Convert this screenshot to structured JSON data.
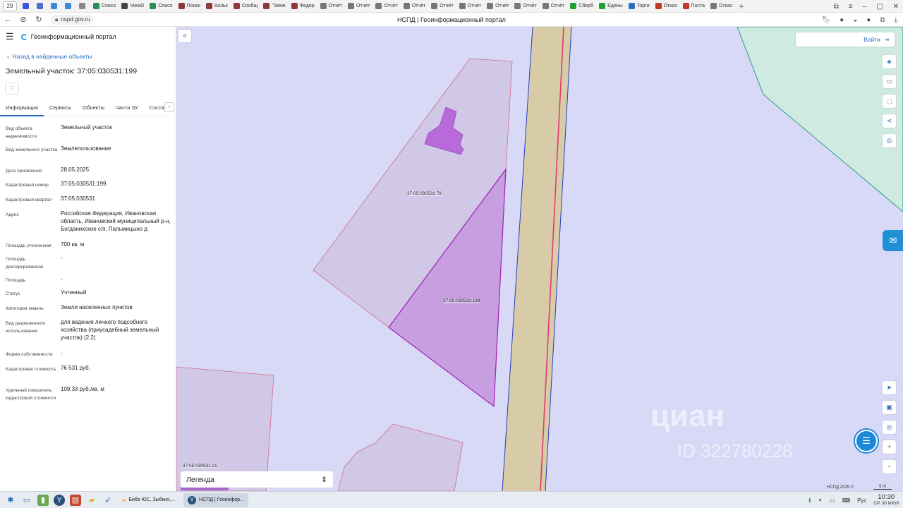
{
  "browser": {
    "tab_count": "29",
    "tabs": [
      {
        "label": "",
        "color": "#3a57d9"
      },
      {
        "label": "",
        "color": "#4a6fd0"
      },
      {
        "label": "",
        "color": "#3f8ad6"
      },
      {
        "label": "",
        "color": "#3f8ad6"
      },
      {
        "label": "",
        "color": "#888888"
      },
      {
        "label": "Списо",
        "color": "#2e8b57"
      },
      {
        "label": "ViewD",
        "color": "#444444"
      },
      {
        "label": "Списо",
        "color": "#2e8b57"
      },
      {
        "label": "Поиск",
        "color": "#8b3a3a"
      },
      {
        "label": "Кальк",
        "color": "#8b3a3a"
      },
      {
        "label": "Сообщ",
        "color": "#8b3a3a"
      },
      {
        "label": "\"Земе",
        "color": "#8b3a3a"
      },
      {
        "label": "Федер",
        "color": "#8b3a3a"
      },
      {
        "label": "Отчёт",
        "color": "#777777"
      },
      {
        "label": "Отчёт",
        "color": "#777777"
      },
      {
        "label": "Отчёт",
        "color": "#777777"
      },
      {
        "label": "Отчёт",
        "color": "#777777"
      },
      {
        "label": "Отчёт",
        "color": "#777777"
      },
      {
        "label": "Отчёт",
        "color": "#777777"
      },
      {
        "label": "Отчёт",
        "color": "#777777"
      },
      {
        "label": "Отчёт",
        "color": "#777777"
      },
      {
        "label": "Отчёт",
        "color": "#777777"
      },
      {
        "label": "Сберб",
        "color": "#21a038"
      },
      {
        "label": "Едины",
        "color": "#21a038"
      },
      {
        "label": "Торги",
        "color": "#2c6bbf"
      },
      {
        "label": "Отказ",
        "color": "#c0392b"
      },
      {
        "label": "Поста",
        "color": "#c0392b"
      },
      {
        "label": "Отказ",
        "color": "#777777"
      }
    ],
    "url": "nspd.gov.ru",
    "page_title": "НСПД | Геоинформационный портал"
  },
  "panel": {
    "brand": "Геоинформационный портал",
    "back_label": "Назад в найденные объекты",
    "title": "Земельный участок: 37:05:030531:199",
    "tabs": [
      "Информация",
      "Сервисы",
      "Объекты",
      "Части ЗУ",
      "Состав"
    ],
    "props": [
      {
        "k": "Вид объекта недвижимости",
        "v": "Земельный участок"
      },
      {
        "k": "Вид земельного участка",
        "v": "Землепользование"
      },
      {
        "k": "Дата присвоения",
        "v": "28.05.2025"
      },
      {
        "k": "Кадастровый номер",
        "v": "37:05:030531:199"
      },
      {
        "k": "Кадастровый квартал",
        "v": "37:05:030531"
      },
      {
        "k": "Адрес",
        "v": "Российская Федерация, Ивановская область, Ивановский муниципальный р-н, Богданихское с/п, Пальмицыно д"
      },
      {
        "k": "Площадь уточненная",
        "v": "700 кв. м"
      },
      {
        "k": "Площадь декларированная",
        "v": "-"
      },
      {
        "k": "Площадь",
        "v": "-"
      },
      {
        "k": "Статус",
        "v": "Учтенный"
      },
      {
        "k": "Категория земель",
        "v": "Земли населенных пунктов"
      },
      {
        "k": "Вид разрешенного использования",
        "v": "для ведения личного подсобного хозяйства (приусадебный земельный участок) (2.2)"
      },
      {
        "k": "Форма собственности",
        "v": "-"
      },
      {
        "k": "Кадастровая стоимость",
        "v": "76 531 руб."
      },
      {
        "k": "Удельный показатель кадастровой стоимости",
        "v": "109,33 руб./кв. м"
      }
    ]
  },
  "map": {
    "login_label": "Войти",
    "labels": {
      "parcel_78": "37:05:030531:78",
      "parcel_199": "37:05:030531:199",
      "parcel_21": "37:05:030531:21"
    },
    "legend_label": "Легенда",
    "footer": "НСПД 2025 ©",
    "scale": "5 m",
    "watermark": "циан",
    "watermark_id": "ID 322780228",
    "colors": {
      "background": "#d8d9f7",
      "road": "#d8cba7",
      "selected_fill": "#c79ee0",
      "selected_stroke": "#a01eb4",
      "parcel_stroke": "#d56a8a",
      "building": "#b96ad9",
      "forest": "#cfeae0"
    }
  },
  "taskbar": {
    "active_task": "НСПД | Геоинфор...",
    "folder_task": "Биба ЮС, Зыбких,...",
    "lang": "Рус",
    "time": "10:30",
    "date": "СР, 30 ИЮЛ"
  }
}
